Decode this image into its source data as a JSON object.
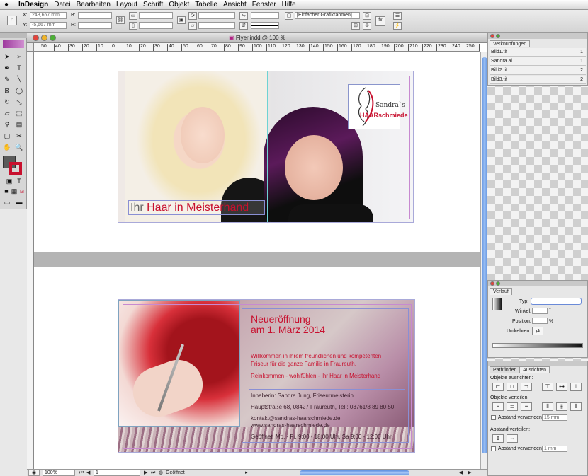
{
  "menu": {
    "apple": "",
    "app": "InDesign",
    "items": [
      "Datei",
      "Bearbeiten",
      "Layout",
      "Schrift",
      "Objekt",
      "Tabelle",
      "Ansicht",
      "Fenster",
      "Hilfe"
    ]
  },
  "control": {
    "x_label": "X:",
    "x_value": "243,667 mm",
    "y_label": "Y:",
    "y_value": "-5,667 mm",
    "b_label": "B:",
    "h_label": "H:",
    "frame_style": "[Einfacher Grafikrahmen]"
  },
  "document": {
    "title": "Flyer.indd @ 100 %",
    "ruler_labels": [
      "50",
      "40",
      "30",
      "20",
      "10",
      "0",
      "10",
      "20",
      "30",
      "40",
      "50",
      "60",
      "70",
      "80",
      "90",
      "100",
      "110",
      "120",
      "130",
      "140",
      "150",
      "160",
      "170",
      "180",
      "190",
      "200",
      "210",
      "220",
      "230",
      "240",
      "250",
      "260"
    ]
  },
  "page1": {
    "headline_prefix": "Ihr",
    "headline_main": "Haar in Meisterhand",
    "logo_line1": "Sandra`s",
    "logo_line2": "HAARschmiede"
  },
  "page2": {
    "heading1": "Neueröffnung",
    "heading2": "am 1. März 2014",
    "welcome1": "Willkommen in ihrem freundlichen und kompetenten",
    "welcome2": "Friseur für die ganze Familie in Fraureuth.",
    "slogan": "Reinkommen - wohlfühlen - Ihr Haar in Meisterhand",
    "owner": "Inhaberin: Sandra  Jung, Friseurmeisterin",
    "address": "Hauptstraße 68, 08427 Fraureuth, Tel.: 03761/8 89 80 50",
    "email": "kontakt@sandras-haarschmiede.de",
    "web": "www.sandras-haarschmiede.de",
    "hours": "Geöffnet: Mo. - Fr. 9:00 - 18:00 Uhr, Sa 9:00 - 12:00 Uhr"
  },
  "status": {
    "zoom": "100%",
    "page": "1",
    "state": "Geöffnet"
  },
  "links_panel": {
    "title": "Verknüpfungen",
    "rows": [
      {
        "name": "Bild1.tif",
        "page": "1"
      },
      {
        "name": "Sandra.ai",
        "page": "1"
      },
      {
        "name": "Bild2.tif",
        "page": "2"
      },
      {
        "name": "Bild3.tif",
        "page": "2"
      }
    ]
  },
  "gradient_panel": {
    "title": "Verlauf",
    "type_label": "Typ:",
    "angle_label": "Winkel:",
    "angle_unit": "°",
    "position_label": "Position:",
    "position_unit": "%",
    "reverse_label": "Umkehren"
  },
  "align_panel": {
    "tab1": "Pathfinder",
    "tab2": "Ausrichten",
    "align_objects": "Objekte ausrichten:",
    "distribute_objects": "Objekte verteilen:",
    "use_spacing1": "Abstand verwenden",
    "spacing1_value": "15 mm",
    "distribute_spacing": "Abstand verteilen:",
    "use_spacing2": "Abstand verwenden",
    "spacing2_value": "1 mm"
  },
  "colors": {
    "accent": "#c8102e",
    "dark_text": "#4a2230",
    "selection": "#9aa0dd"
  }
}
